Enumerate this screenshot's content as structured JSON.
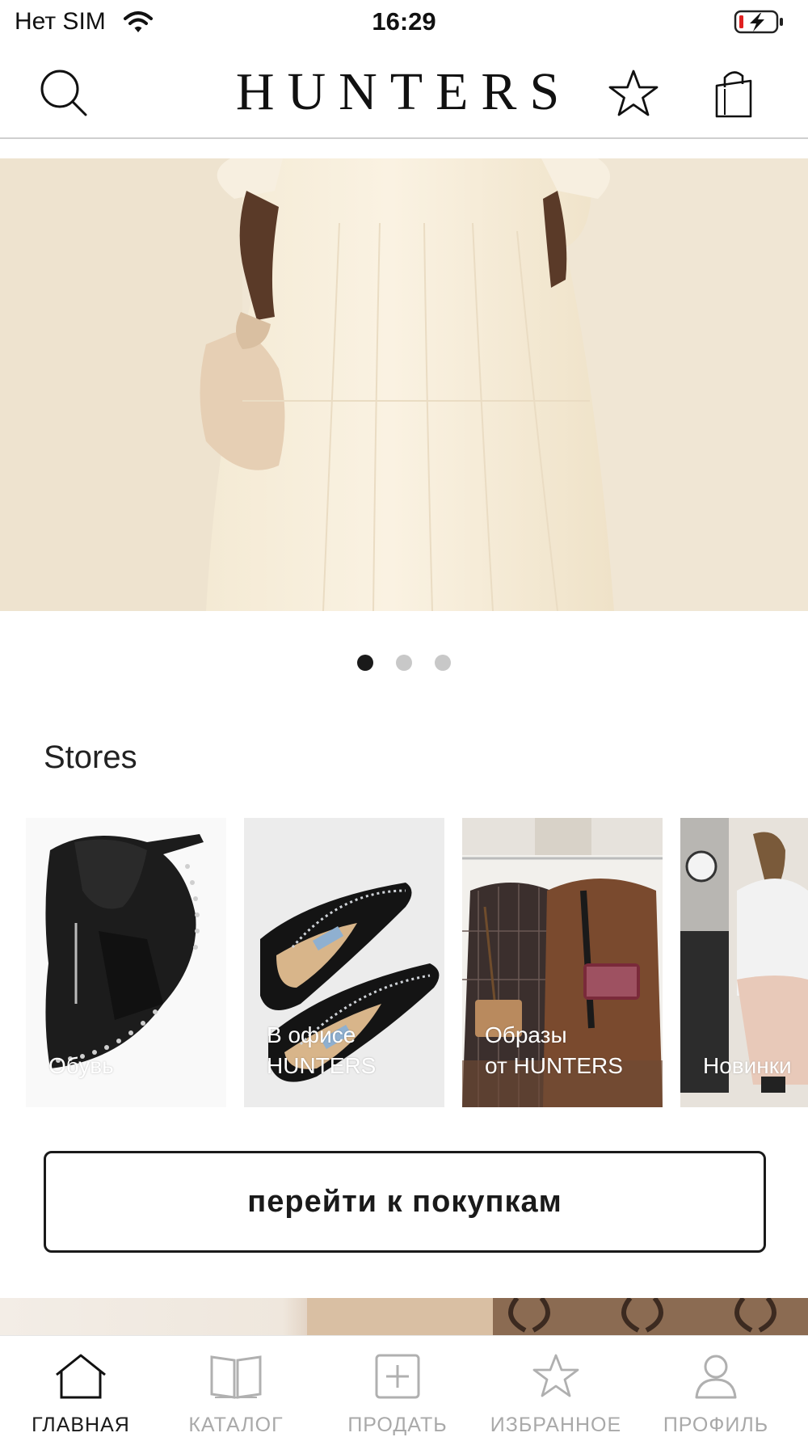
{
  "status_bar": {
    "carrier": "Нет SIM",
    "time": "16:29",
    "icons": [
      "wifi-icon",
      "battery-charging-icon"
    ]
  },
  "header": {
    "logo": "HUNTERS",
    "icons": [
      "search-icon",
      "star-icon",
      "shopping-bag-icon"
    ]
  },
  "hero": {
    "slides_total": 3,
    "active_slide": 1
  },
  "stores": {
    "title": "Stores",
    "items": [
      {
        "label": "Обувь"
      },
      {
        "label": "В офисе\nHUNTERS"
      },
      {
        "label": "Образы\nот HUNTERS"
      },
      {
        "label": "Новинки"
      }
    ]
  },
  "cta": {
    "label": "перейти к покупкам"
  },
  "tabbar": {
    "active": "ГЛАВНАЯ",
    "items": [
      {
        "label": "ГЛАВНАЯ",
        "icon": "home-icon"
      },
      {
        "label": "КАТАЛОГ",
        "icon": "book-icon"
      },
      {
        "label": "ПРОДАТЬ",
        "icon": "plus-square-icon"
      },
      {
        "label": "ИЗБРАННОЕ",
        "icon": "star-icon"
      },
      {
        "label": "ПРОФИЛЬ",
        "icon": "person-icon"
      }
    ]
  },
  "colors": {
    "text": "#111111",
    "inactive": "#a9a9a9",
    "divider": "#cfcfcf",
    "battery_low": "#e02020"
  }
}
